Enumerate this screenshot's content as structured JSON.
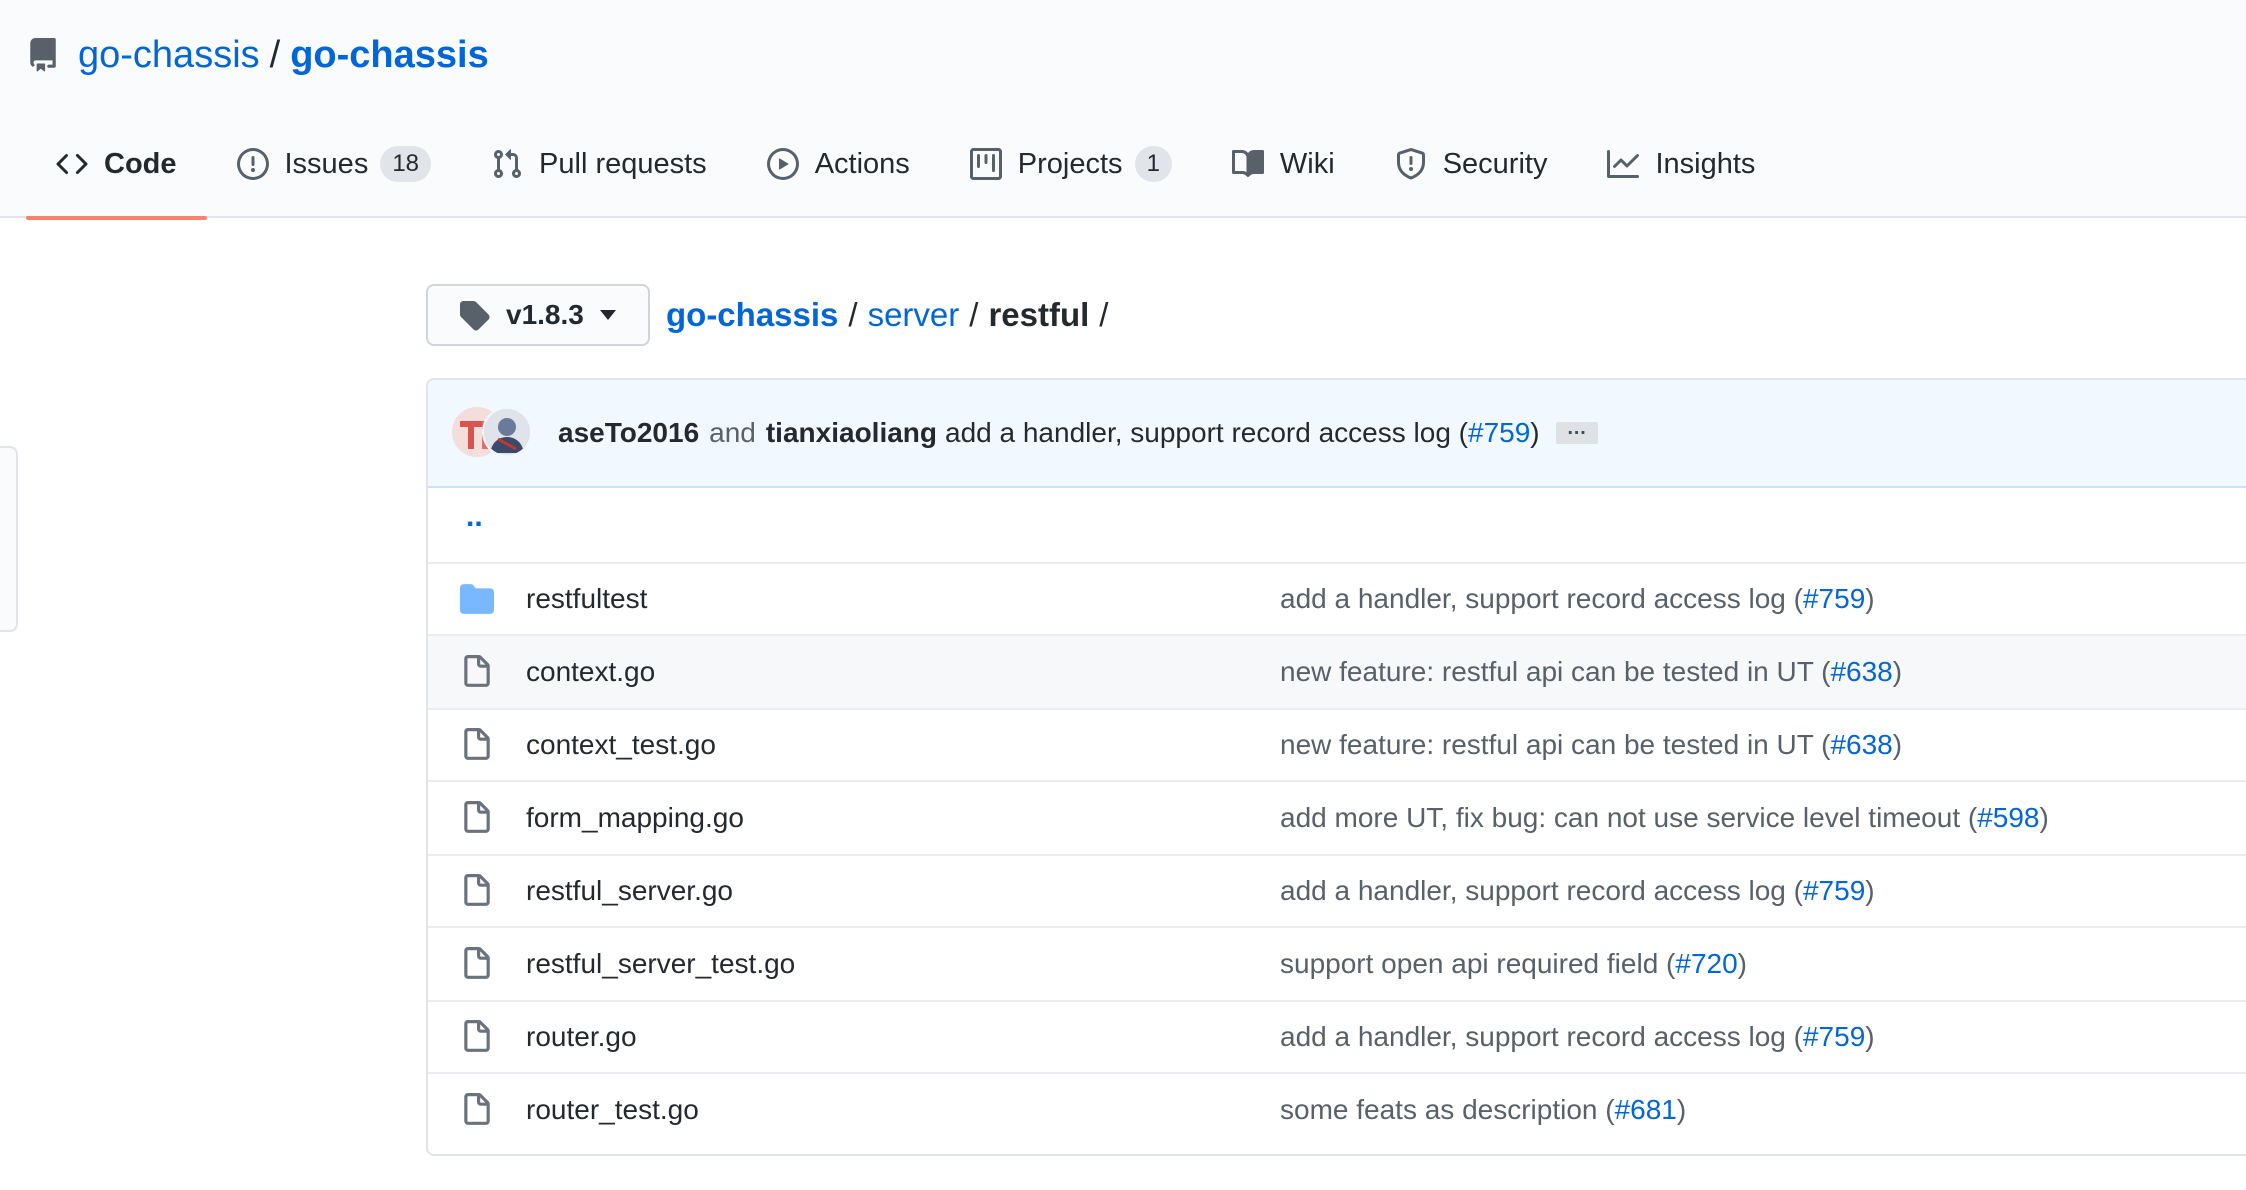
{
  "repo": {
    "owner": "go-chassis",
    "separator": "/",
    "name": "go-chassis",
    "icon": "repo-icon"
  },
  "tabs": [
    {
      "label": "Code",
      "icon": "code-icon",
      "selected": true
    },
    {
      "label": "Issues",
      "icon": "issue-opened-icon",
      "count": "18"
    },
    {
      "label": "Pull requests",
      "icon": "git-pull-request-icon"
    },
    {
      "label": "Actions",
      "icon": "play-icon"
    },
    {
      "label": "Projects",
      "icon": "project-icon",
      "count": "1"
    },
    {
      "label": "Wiki",
      "icon": "book-icon"
    },
    {
      "label": "Security",
      "icon": "shield-icon"
    },
    {
      "label": "Insights",
      "icon": "graph-icon"
    }
  ],
  "branch": {
    "label": "v1.8.3",
    "icon": "tag-icon"
  },
  "breadcrumb": {
    "root": "go-chassis",
    "sep": "/",
    "dir": "server",
    "current": "restful",
    "trailing": "/"
  },
  "commit": {
    "author1": "aseTo2016",
    "conjunction": "and",
    "author2": "tianxiaoliang",
    "message": "add a handler, support record access log (",
    "pr": "#759",
    "message_end": ")",
    "ellipsis": "…"
  },
  "parent_dir": "..",
  "files": [
    {
      "name": "restfultest",
      "type": "folder",
      "message": "add a handler, support record access log (",
      "pr": "#759",
      "end": ")"
    },
    {
      "name": "context.go",
      "type": "file",
      "message": "new feature: restful api can be tested in UT (",
      "pr": "#638",
      "end": ")"
    },
    {
      "name": "context_test.go",
      "type": "file",
      "message": "new feature: restful api can be tested in UT (",
      "pr": "#638",
      "end": ")"
    },
    {
      "name": "form_mapping.go",
      "type": "file",
      "message": "add more UT, fix bug: can not use service level timeout (",
      "pr": "#598",
      "end": ")"
    },
    {
      "name": "restful_server.go",
      "type": "file",
      "message": "add a handler, support record access log (",
      "pr": "#759",
      "end": ")"
    },
    {
      "name": "restful_server_test.go",
      "type": "file",
      "message": "support open api required field (",
      "pr": "#720",
      "end": ")"
    },
    {
      "name": "router.go",
      "type": "file",
      "message": "add a handler, support record access log (",
      "pr": "#759",
      "end": ")"
    },
    {
      "name": "router_test.go",
      "type": "file",
      "message": "some feats as description (",
      "pr": "#681",
      "end": ")"
    }
  ],
  "colors": {
    "link": "#0366d6",
    "selected_tab_underline": "#f9826c",
    "folder": "#79b8ff",
    "commit_bar_bg": "#f1f8ff"
  }
}
